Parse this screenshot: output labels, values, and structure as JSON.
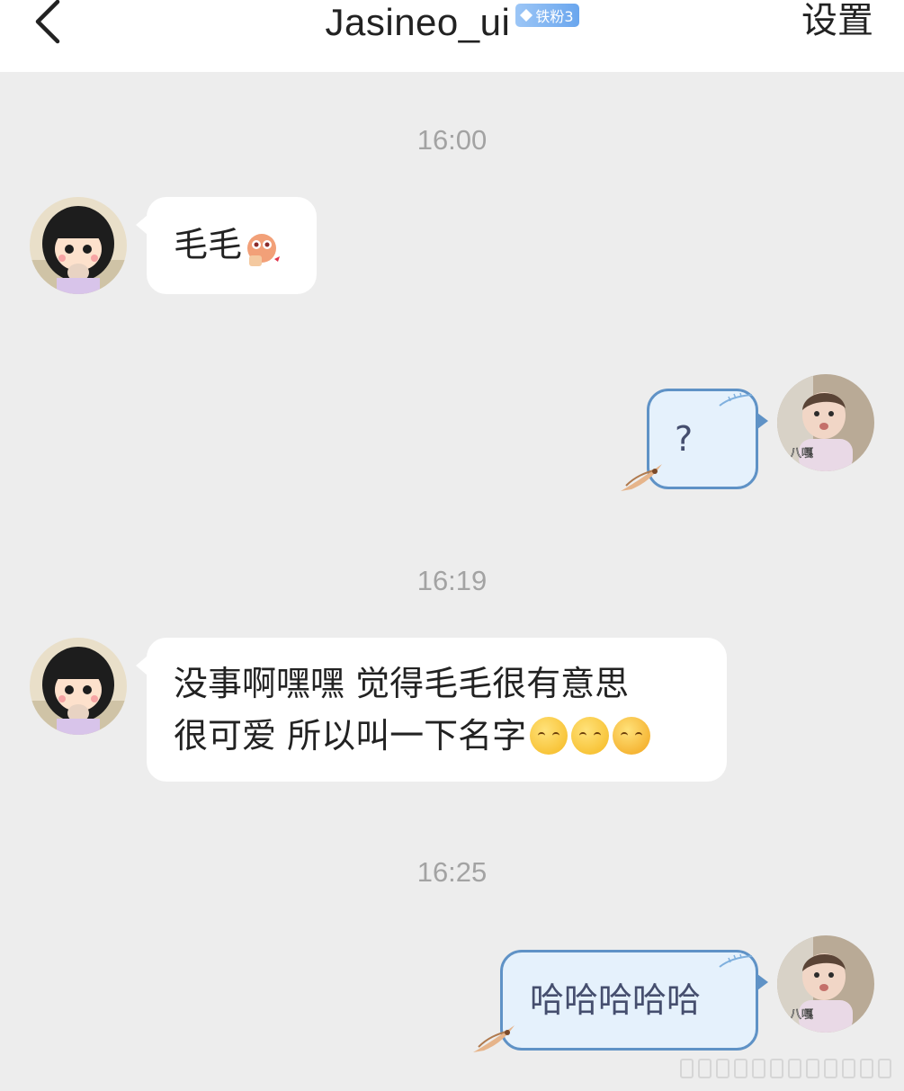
{
  "header": {
    "back_icon": "chevron-left-icon",
    "title": "Jasineo_ui",
    "badge": {
      "icon": "diamond-icon",
      "label": "铁粉3",
      "color": "#79b0f0"
    },
    "settings_label": "设置"
  },
  "colors": {
    "background": "#ededed",
    "incoming_bubble": "#ffffff",
    "outgoing_bubble": "#e5f1fc",
    "outgoing_border": "#5f92c6",
    "timestamp": "#a3a3a3"
  },
  "chat": {
    "time_1": "16:00",
    "msg_1": {
      "sender": "other",
      "text": "毛毛",
      "sticker_icon": "cartoon-sticker-icon"
    },
    "msg_2": {
      "sender": "me",
      "text": "?"
    },
    "time_2": "16:19",
    "msg_3": {
      "sender": "other",
      "line_1": "没事啊嘿嘿 觉得毛毛很有意思",
      "line_2": "很可爱 所以叫一下名字",
      "emojis": [
        "kiss-emoji-icon",
        "kiss-emoji-icon",
        "flower-emoji-icon"
      ]
    },
    "time_3": "16:25",
    "msg_4": {
      "sender": "me",
      "text": "哈哈哈哈哈"
    }
  },
  "avatars": {
    "other": "cartoon-girl-avatar",
    "me": {
      "image": "baby-photo-avatar",
      "caption": "八嘎"
    }
  }
}
